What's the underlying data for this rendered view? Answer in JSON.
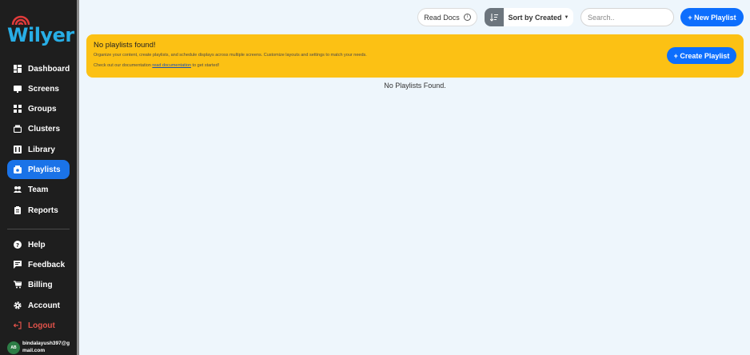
{
  "app": {
    "logo_text": "Wilyer"
  },
  "sidebar": {
    "items": [
      {
        "label": "Dashboard",
        "icon": "dashboard-icon"
      },
      {
        "label": "Screens",
        "icon": "screen-icon"
      },
      {
        "label": "Groups",
        "icon": "groups-icon"
      },
      {
        "label": "Clusters",
        "icon": "clusters-icon"
      },
      {
        "label": "Library",
        "icon": "library-icon"
      },
      {
        "label": "Playlists",
        "icon": "playlist-icon",
        "active": true
      },
      {
        "label": "Team",
        "icon": "team-icon"
      },
      {
        "label": "Reports",
        "icon": "reports-icon"
      }
    ],
    "bottom_items": [
      {
        "label": "Help",
        "icon": "help-icon"
      },
      {
        "label": "Feedback",
        "icon": "feedback-icon"
      },
      {
        "label": "Billing",
        "icon": "cart-icon"
      },
      {
        "label": "Account",
        "icon": "gear-icon"
      },
      {
        "label": "Logout",
        "icon": "logout-icon"
      }
    ],
    "user": {
      "initials": "AB",
      "email": "bindalayush397@gmail.com"
    }
  },
  "toolbar": {
    "read_docs_label": "Read Docs",
    "sort_label": "Sort by Created",
    "search_placeholder": "Search..",
    "new_playlist_label": "+ New Playlist"
  },
  "alert": {
    "title": "No playlists found!",
    "description": "Organize your content, create playlists, and schedule displays across multiple screens. Customize layouts and settings to match your needs.",
    "doc_prefix": "Check out our documentation",
    "doc_link": "read documentation",
    "doc_suffix": "to get started!",
    "create_label": "+ Create Playlist"
  },
  "main": {
    "empty_message": "No Playlists Found."
  },
  "colors": {
    "accent": "#0d6efd",
    "sidebar_bg": "#1e1e1e",
    "alert_bg": "#fcc114",
    "logout": "#e0524a"
  }
}
